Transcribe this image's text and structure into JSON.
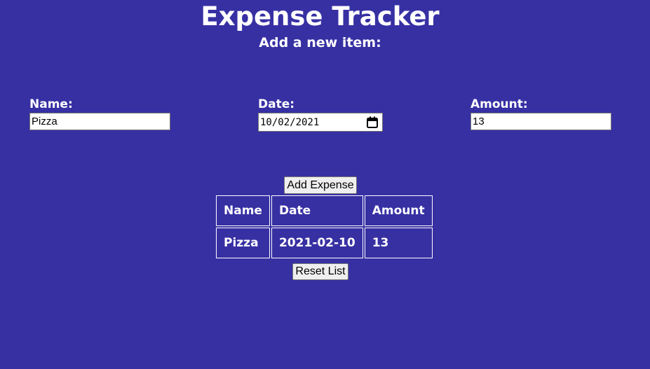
{
  "header": {
    "title": "Expense Tracker",
    "subtitle": "Add a new item:"
  },
  "form": {
    "name": {
      "label": "Name:",
      "value": "Pizza"
    },
    "date": {
      "label": "Date:",
      "value": "10/02/2021",
      "icon": "calendar-icon"
    },
    "amount": {
      "label": "Amount:",
      "value": "13"
    }
  },
  "buttons": {
    "add_label": "Add Expense",
    "reset_label": "Reset List"
  },
  "table": {
    "headers": [
      "Name",
      "Date",
      "Amount"
    ],
    "rows": [
      [
        "Pizza",
        "2021-02-10",
        "13"
      ]
    ]
  },
  "colors": {
    "background": "#3730a3",
    "text": "#ffffff",
    "border": "#ffffff"
  }
}
